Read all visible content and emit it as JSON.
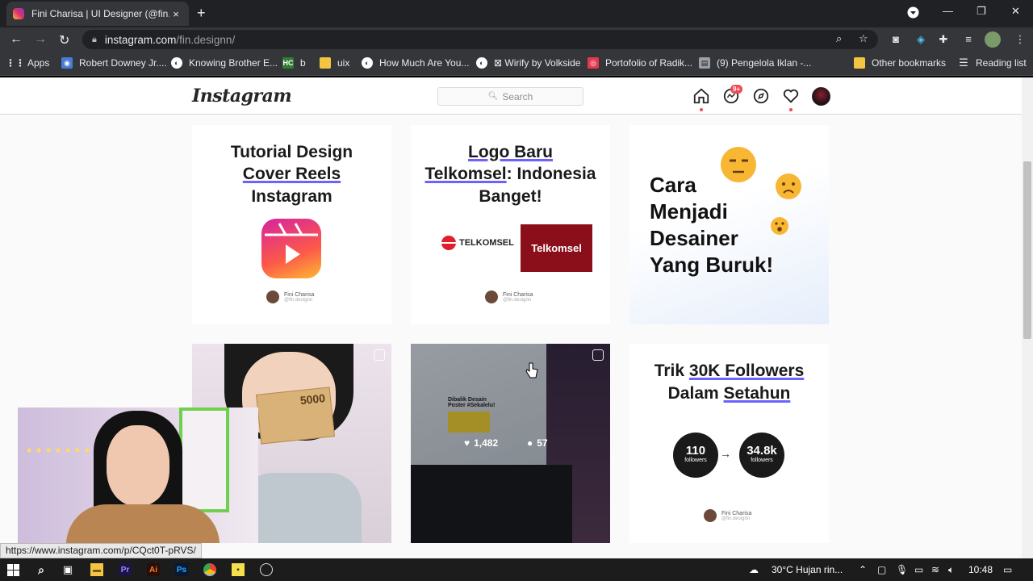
{
  "browser": {
    "tab_title": "Fini Charisa | UI Designer (@fin.d",
    "tab_close": "×",
    "new_tab": "+",
    "url_host": "instagram.com",
    "url_path": "/fin.designn/",
    "window_min": "—",
    "window_max": "❐",
    "window_close": "✕"
  },
  "bookmarks": [
    {
      "label": "Apps",
      "icon": "apps-grid-icon"
    },
    {
      "label": "Robert Downey Jr....",
      "icon": "camera-icon"
    },
    {
      "label": "Knowing Brother E...",
      "icon": "globe-icon"
    },
    {
      "label": "b",
      "icon": "hc-icon"
    },
    {
      "label": "uix",
      "icon": "folder-icon"
    },
    {
      "label": "How Much Are You...",
      "icon": "globe-icon"
    },
    {
      "label": "⊠ Wirify by Volkside",
      "icon": "globe-icon"
    },
    {
      "label": "Portofolio of Radik...",
      "icon": "portfolio-icon"
    },
    {
      "label": "(9) Pengelola Iklan -...",
      "icon": "ads-icon"
    },
    {
      "label": "Other bookmarks",
      "icon": "folder-icon"
    },
    {
      "label": "Reading list",
      "icon": "reading-list-icon"
    }
  ],
  "instagram": {
    "logo": "Instagram",
    "search_placeholder": "Search",
    "messages_badge": "9+"
  },
  "posts": {
    "p1": {
      "line1": "Tutorial Design",
      "line2": "Cover Reels",
      "line3": "Instagram",
      "name": "Fini Charisa",
      "handle": "@fin.designn"
    },
    "p2": {
      "line1": "Logo Baru",
      "line2": "Telkomsel",
      "line2b": ": Indonesia",
      "line3": "Banget!",
      "brand1": "TELKOMSEL",
      "brand2": "Telkomsel",
      "name": "Fini Charisa",
      "handle": "@fin.designn"
    },
    "p3": {
      "line1": "Cara",
      "line2": "Menjadi",
      "line3": "Desainer",
      "line4": "Yang Buruk!"
    },
    "p4": {
      "money": "5000"
    },
    "p5": {
      "likes": "1,482",
      "comments": "57",
      "screen_text": "Dibalik Desain Poster #Sekalelu!"
    },
    "p6": {
      "line1a": "Trik ",
      "line1b": "30K Followers",
      "line2a": "Dalam ",
      "line2b": "Setahun",
      "from_num": "110",
      "from_label": "followers",
      "to_num": "34.8k",
      "to_label": "followers",
      "name": "Fini Charisa",
      "handle": "@fin.designn"
    }
  },
  "status_url": "https://www.instagram.com/p/CQct0T-pRVS/",
  "taskbar": {
    "weather": "30°C  Hujan rin...",
    "clock": "10:48"
  },
  "colors": {
    "accent_red": "#ed4956",
    "underline": "#6c63ff",
    "telkomsel": "#8b0f1a"
  }
}
